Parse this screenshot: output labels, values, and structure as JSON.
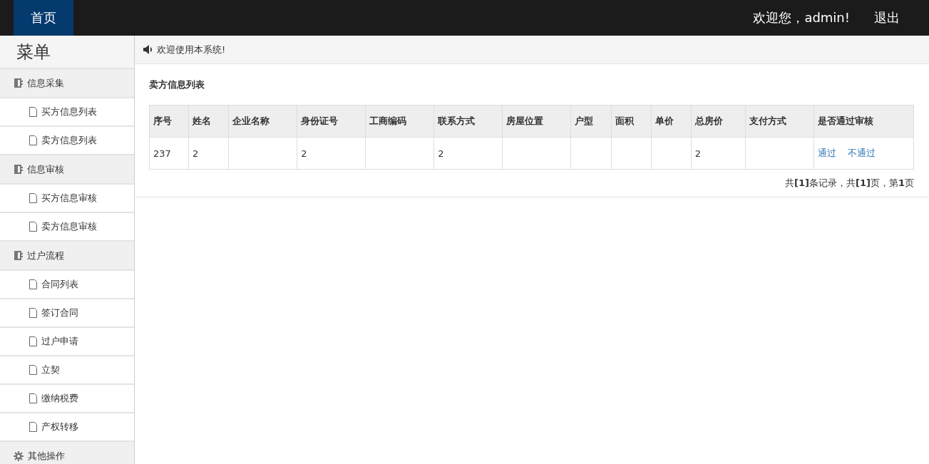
{
  "top_nav": {
    "tabs": [
      {
        "label": "首页",
        "selected": true
      }
    ],
    "welcome": "欢迎您，admin!",
    "logout": "退出"
  },
  "sidebar": {
    "title": "菜单",
    "groups": [
      {
        "kind": "section",
        "label": "信息采集",
        "items": [
          "买方信息列表",
          "卖方信息列表"
        ]
      },
      {
        "kind": "section",
        "label": "信息审核",
        "items": [
          "买方信息审核",
          "卖方信息审核"
        ]
      },
      {
        "kind": "section",
        "label": "过户流程",
        "items": [
          "合同列表",
          "签订合同",
          "过户申请",
          "立契",
          "缴纳税费",
          "产权转移"
        ]
      },
      {
        "kind": "settings",
        "label": "其他操作"
      }
    ]
  },
  "notice": "欢迎使用本系统!",
  "section_title": "卖方信息列表",
  "table": {
    "columns": [
      "序号",
      "姓名",
      "企业名称",
      "身份证号",
      "工商编码",
      "联系方式",
      "房屋位置",
      "户型",
      "面积",
      "单价",
      "总房价",
      "支付方式",
      "是否通过审核"
    ],
    "rows": [
      {
        "cells": [
          "237",
          "2",
          "",
          "2",
          "",
          "2",
          "",
          "",
          "",
          "",
          "2",
          ""
        ],
        "actions": [
          "通过",
          "不通过"
        ]
      }
    ]
  },
  "pagination": "共**[1]**条记录，共**[1]**页，第**1**页"
}
